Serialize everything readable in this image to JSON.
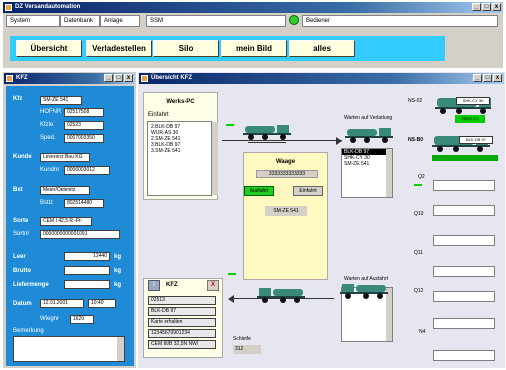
{
  "app": {
    "title": "DZ Versandautomation",
    "wbtn": [
      "_",
      "□",
      "x"
    ]
  },
  "menu": {
    "system": "System",
    "datenbank": "Datenbank",
    "anlage": "Anlage",
    "ssm": "SSM",
    "user": "Bediener"
  },
  "nav": [
    "Übersicht",
    "Verladestellen",
    "Silo",
    "mein Bild",
    "alles"
  ],
  "kfz_window": {
    "title": "KFZ",
    "rows": [
      {
        "label": "Kfz",
        "sub": "",
        "value": "SM-ZE 541"
      },
      {
        "label": "",
        "sub": "HOFNR",
        "value": "02517508"
      },
      {
        "label": "",
        "sub": "Kfzle",
        "value": "02523"
      },
      {
        "label": "",
        "sub": "Sped.",
        "value": "0007003350"
      },
      {
        "label": "Kunde",
        "sub": "",
        "value": "Leverenz Bau KG"
      },
      {
        "label": "",
        "sub": "Kundnr",
        "value": "0006003012"
      },
      {
        "label": "Bst",
        "sub": "",
        "value": "Meier/Oelenitz"
      },
      {
        "label": "",
        "sub": "Bstlz",
        "value": "802514480"
      },
      {
        "label": "Sorte",
        "sub": "",
        "value": "CEM I 42,5 R -Ft-"
      },
      {
        "label": "Sortnr",
        "sub": "",
        "value": "0000000000001091"
      }
    ],
    "leer_label": "Leer",
    "leer_value": "12440",
    "unit": "kg",
    "brutto_label": "Brutto",
    "liefer_label": "Liefermenge",
    "datum_label": "Datum",
    "datum_value": "12.01.2001",
    "time_value": "10:40",
    "wiegnr_label": "Wiegnr",
    "wiegnr_value": "1620",
    "bemerkung_label": "Bemerkung"
  },
  "overview": {
    "title": "Übersicht KFZ",
    "werks_pc": {
      "title": "Werks-PC",
      "sub": "Einfahrt",
      "items": [
        "2.BLK-DB 97",
        "WUR-AS 30",
        "2.SM-ZE 541",
        "3.BLK-DB 97",
        "3.SM-ZE 541"
      ]
    },
    "waage": {
      "title": "Waage",
      "display": "3333333333333",
      "ausfahrt": "Ausfahrt",
      "einfahrt": "Einfahrt",
      "plate": "SM-ZE 541"
    },
    "warten_verladung": {
      "title": "Warten auf Verladung",
      "items": [
        "BLK-DB 97",
        "SHK-CY 30",
        "SM-ZE 541"
      ]
    },
    "warten_ausfahrt": "Warten auf Ausfahrt",
    "stations": [
      "NS-02",
      "NS-B0",
      "Q2",
      "Q10",
      "Q11",
      "Q12",
      "N4"
    ],
    "truck_plates": [
      "SHK-CY 30",
      "BLK-DB 97"
    ],
    "green_labels": [
      "FRLR-T.1"
    ],
    "kfz_panel": {
      "info": "i",
      "title": "KFZ",
      "close": "X",
      "fields": [
        "02513",
        "BLK-DB 97",
        "Karte erhalten",
        "12345670901234",
        "CEM III/B 32,5N NW/"
      ]
    },
    "schleife": {
      "label": "Schleife",
      "value": "312"
    }
  }
}
